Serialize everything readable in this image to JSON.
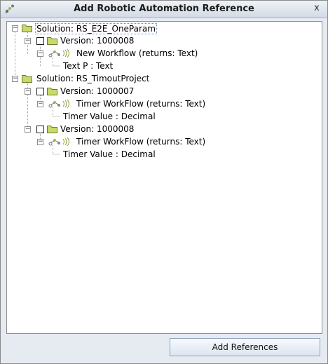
{
  "window": {
    "title": "Add Robotic Automation Reference",
    "close_glyph": "x"
  },
  "tree": {
    "solutions": [
      {
        "label": "Solution: RS_E2E_OneParam",
        "versions": [
          {
            "label": "Version: 1000008",
            "checked": false,
            "workflow": "New Workflow (returns: Text)",
            "params": [
              "Text P : Text"
            ]
          }
        ]
      },
      {
        "label": "Solution: RS_TimoutProject",
        "versions": [
          {
            "label": "Version: 1000007",
            "checked": false,
            "workflow": "Timer WorkFlow (returns: Text)",
            "params": [
              "Timer Value : Decimal"
            ]
          },
          {
            "label": "Version: 1000008",
            "checked": false,
            "workflow": "Timer WorkFlow (returns: Text)",
            "params": [
              "Timer Value : Decimal"
            ]
          }
        ]
      }
    ]
  },
  "footer": {
    "add_references_label": "Add References"
  },
  "colors": {
    "folder": "#c9d96b",
    "selected_outline": "#6c8fbf"
  }
}
